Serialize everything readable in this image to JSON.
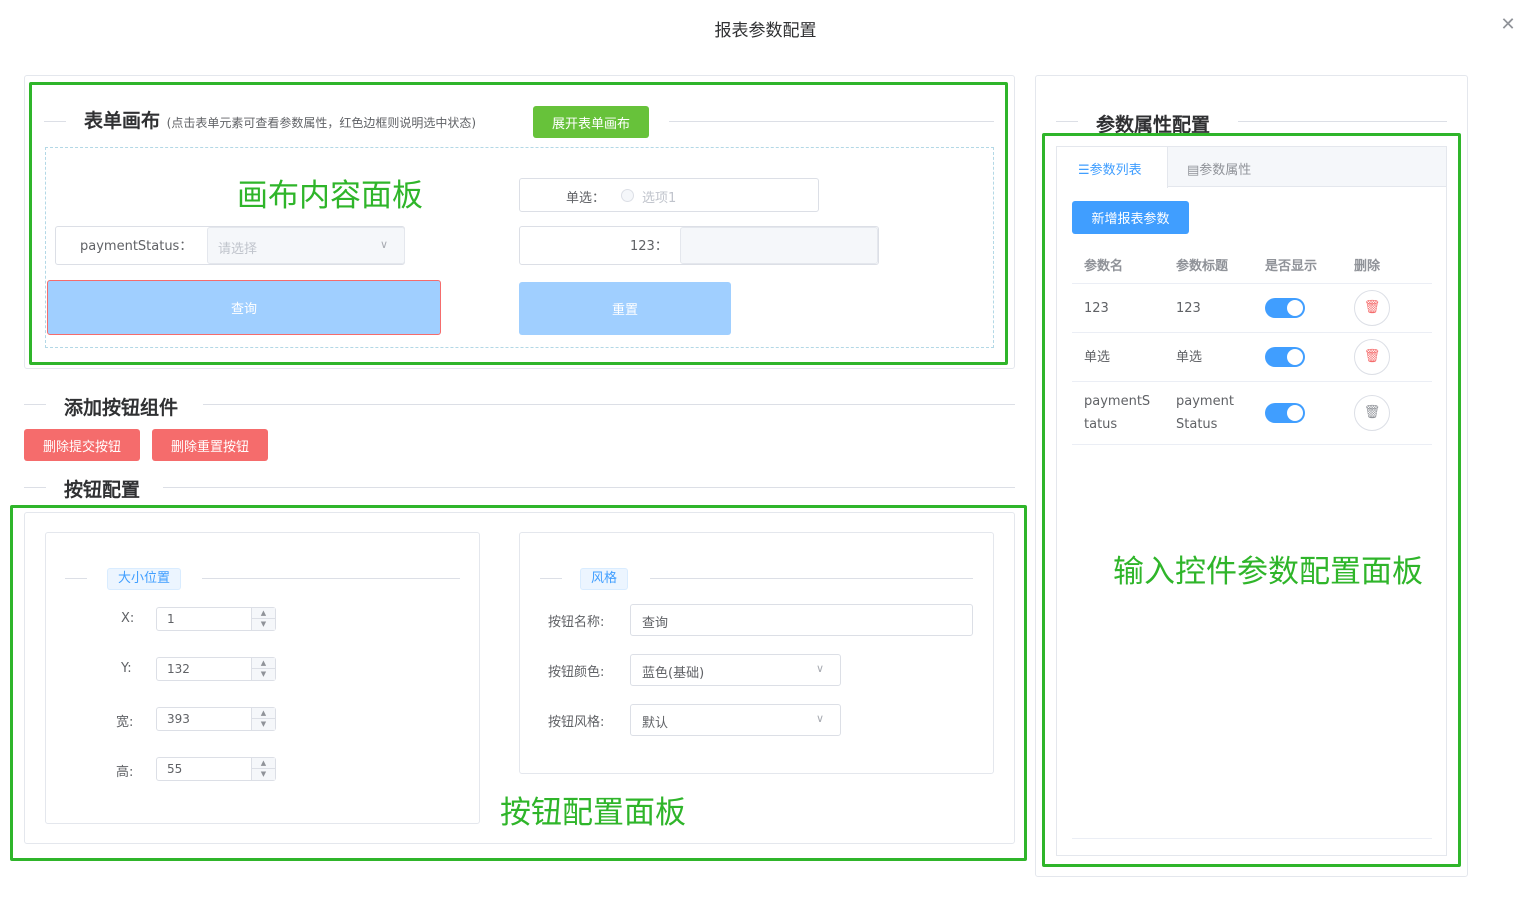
{
  "dialog": {
    "title": "报表参数配置",
    "close_icon": "close-icon"
  },
  "canvas": {
    "title": "表单画布",
    "hint": "(点击表单元素可查看参数属性，红色边框则说明选中状态)",
    "expand_button": "展开表单画布",
    "annotation": "画布内容面板",
    "radio_label": "单选：",
    "radio_option": "选项1",
    "payment_label": "paymentStatus：",
    "payment_placeholder": "请选择",
    "field123_label": "123：",
    "query_button": "查询",
    "reset_button": "重置"
  },
  "add_buttons": {
    "title": "添加按钮组件",
    "delete_submit": "删除提交按钮",
    "delete_reset": "删除重置按钮"
  },
  "button_config": {
    "title": "按钮配置",
    "annotation": "按钮配置面板",
    "size_position": {
      "tag": "大小位置",
      "x_label": "X:",
      "x_value": "1",
      "y_label": "Y:",
      "y_value": "132",
      "w_label": "宽:",
      "w_value": "393",
      "h_label": "高:",
      "h_value": "55"
    },
    "style": {
      "tag": "风格",
      "name_label": "按钮名称:",
      "name_value": "查询",
      "color_label": "按钮颜色:",
      "color_value": "蓝色(基础)",
      "style_label": "按钮风格:",
      "style_value": "默认"
    }
  },
  "param_config": {
    "title": "参数属性配置",
    "annotation": "输入控件参数配置面板",
    "tabs": [
      {
        "label": "参数列表",
        "icon": "list-icon"
      },
      {
        "label": "参数属性",
        "icon": "form-icon"
      }
    ],
    "add_button": "新增报表参数",
    "columns": [
      "参数名",
      "参数标题",
      "是否显示",
      "删除"
    ],
    "rows": [
      {
        "name": "123",
        "title": "123",
        "shown": true
      },
      {
        "name": "单选",
        "title": "单选",
        "shown": true
      },
      {
        "name": "paymentStatus",
        "name_line1": "paymentS",
        "name_line2": "tatus",
        "title": "paymentStatus",
        "title_line1": "payment",
        "title_line2": "Status",
        "shown": true
      }
    ]
  },
  "colors": {
    "accent": "#409eff",
    "annotation_green": "#2fb52a",
    "danger": "#f56c6c",
    "success": "#67c23a"
  }
}
